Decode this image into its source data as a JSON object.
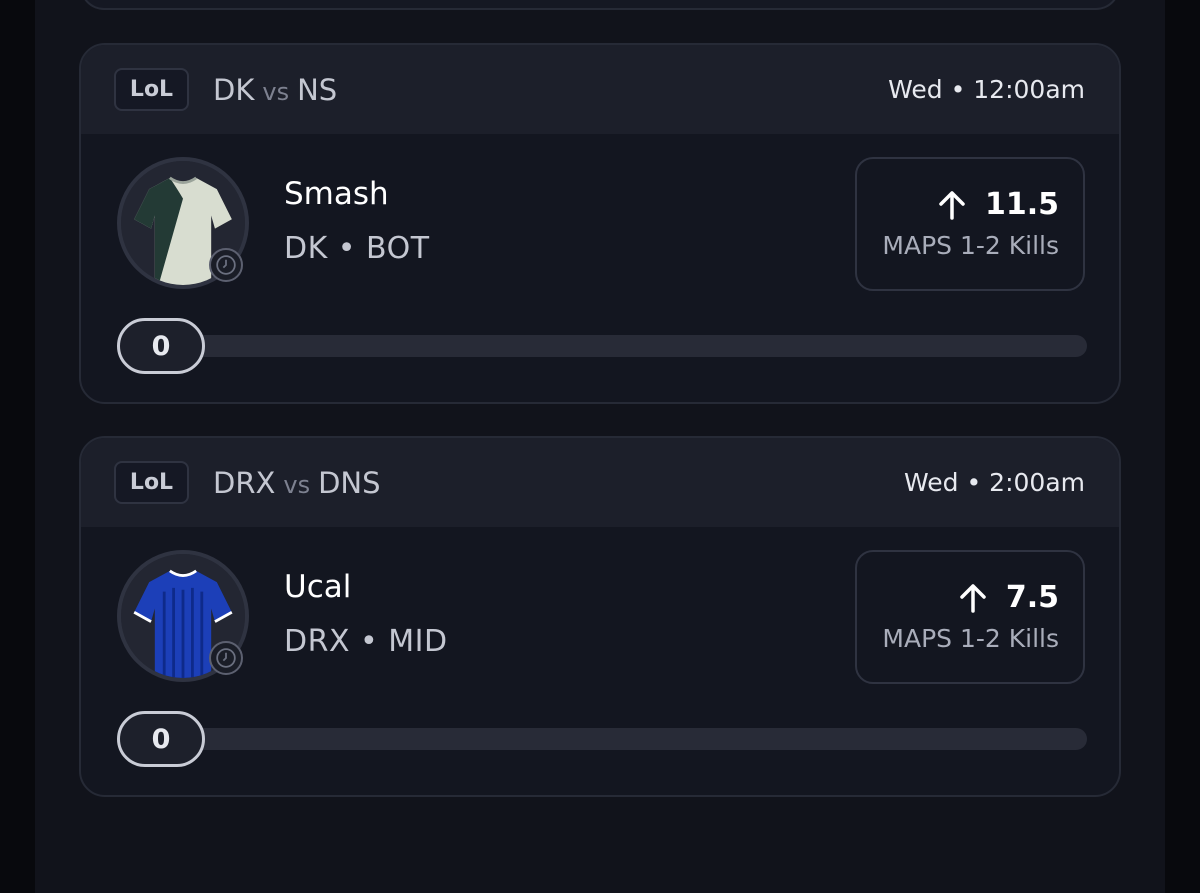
{
  "cards": [
    {
      "game": "LoL",
      "team1": "DK",
      "vs": "vs",
      "team2": "NS",
      "time": "Wed • 12:00am",
      "player": "Smash",
      "player_meta": "DK • BOT",
      "line": "11.5",
      "direction": "up",
      "stat": "MAPS 1-2 Kills",
      "progress_value": "0",
      "progress_fraction": 0,
      "jersey_color": "#d8ddd0"
    },
    {
      "game": "LoL",
      "team1": "DRX",
      "vs": "vs",
      "team2": "DNS",
      "time": "Wed • 2:00am",
      "player": "Ucal",
      "player_meta": "DRX • MID",
      "line": "7.5",
      "direction": "up",
      "stat": "MAPS 1-2 Kills",
      "progress_value": "0",
      "progress_fraction": 0,
      "jersey_color": "#1c3fb8"
    }
  ],
  "icons": {
    "arrow": "arrow-up-icon",
    "clock": "clock-icon",
    "jersey": "jersey-icon"
  }
}
